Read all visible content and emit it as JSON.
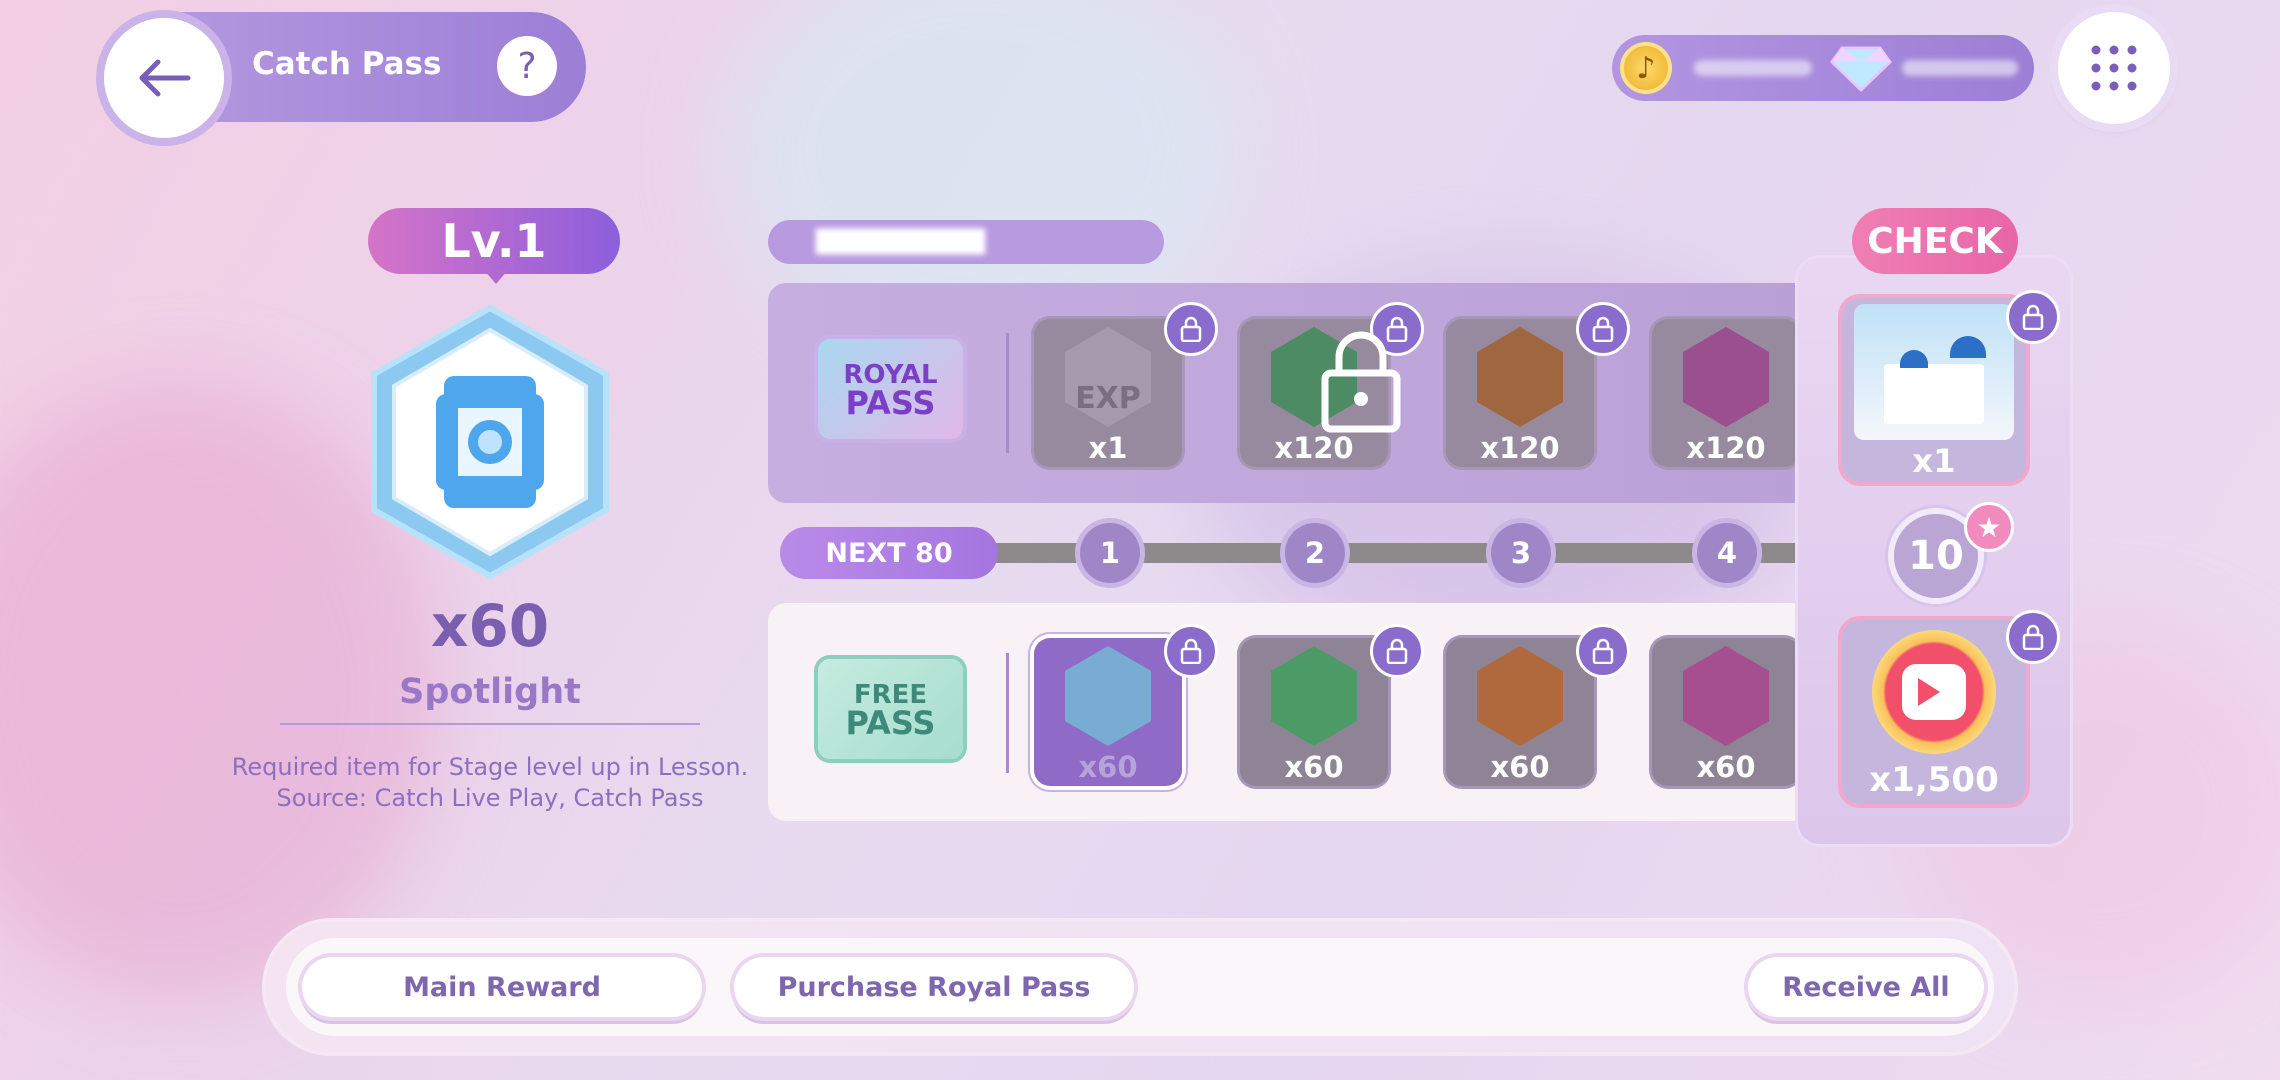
{
  "header": {
    "title": "Catch Pass",
    "help_label": "?"
  },
  "currency": {
    "coin_icon": "music-note-coin-icon",
    "gem_icon": "diamond-icon"
  },
  "level": {
    "badge": "Lv.1",
    "count": "x60",
    "item_name": "Spotlight",
    "description_lines": [
      "Required item for Stage level up in Lesson.",
      "Source: Catch Live Play, Catch Pass"
    ]
  },
  "royal_pass": {
    "label_top": "ROYAL",
    "label_bottom": "PASS",
    "rewards": [
      {
        "icon": "exp-icon",
        "label": "EXP",
        "qty": "x1"
      },
      {
        "icon": "microphone-icon",
        "qty": "x120"
      },
      {
        "icon": "speaker-icon",
        "qty": "x120"
      },
      {
        "icon": "camera-icon",
        "qty": "x120"
      }
    ]
  },
  "progress": {
    "next_label": "NEXT 80",
    "nodes": [
      "1",
      "2",
      "3",
      "4"
    ]
  },
  "free_pass": {
    "label_top": "FREE",
    "label_bottom": "PASS",
    "rewards": [
      {
        "icon": "spotlight-icon",
        "qty": "x60"
      },
      {
        "icon": "microphone-icon",
        "qty": "x60"
      },
      {
        "icon": "speaker-icon",
        "qty": "x60"
      },
      {
        "icon": "camera-icon",
        "qty": "x60"
      }
    ]
  },
  "side_panel": {
    "check_label": "CHECK",
    "top_reward_qty": "x1",
    "milestone_level": "10",
    "bottom_reward_qty": "x1,500"
  },
  "footer": {
    "main_reward": "Main Reward",
    "purchase_royal": "Purchase Royal Pass",
    "receive_all": "Receive All"
  },
  "colors": {
    "accent": "#9c7fd6",
    "check_pink": "#ec6fab",
    "locked_gray": "#8f8496"
  }
}
